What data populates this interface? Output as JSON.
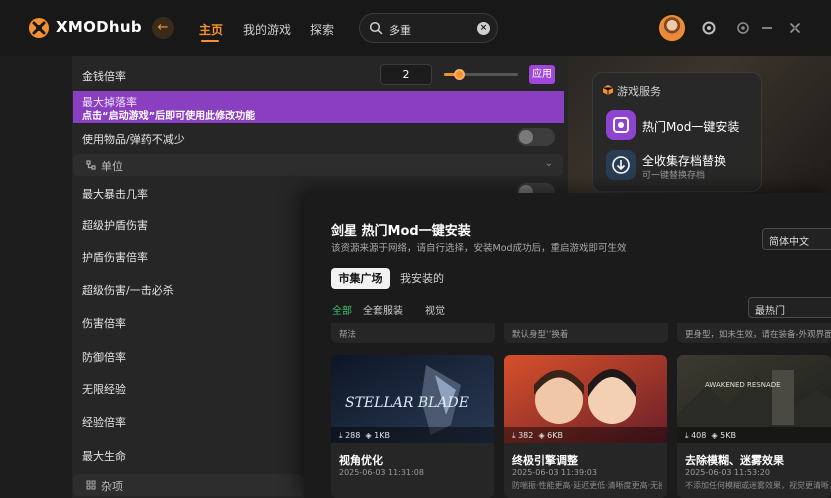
{
  "app": {
    "name": "XMODhub"
  },
  "colors": {
    "accent": "#f5922f",
    "purple": "#a046d8",
    "highlight_row": "#8a3fc0",
    "green": "#3cc36c"
  },
  "nav": {
    "items": [
      "主页",
      "我的游戏",
      "探索"
    ],
    "active": "主页"
  },
  "search": {
    "value": "多重"
  },
  "settings": {
    "money_rate": {
      "label": "金钱倍率",
      "value": "2",
      "slider_fraction": 0.2,
      "apply": "应用"
    },
    "drop_rate": {
      "label": "最大掉落率",
      "hint": "点击“启动游戏”后即可使用此修改功能"
    },
    "no_consume": {
      "label": "使用物品/弹药不减少"
    },
    "unit_section": "单位",
    "unit_items": [
      "最大暴击几率",
      "超级护盾伤害",
      "护盾伤害倍率",
      "超级伤害/一击必杀",
      "伤害倍率",
      "防御倍率",
      "无限经验",
      "经验倍率",
      "最大生命"
    ],
    "misc_section": "杂项"
  },
  "services": {
    "title": "游戏服务",
    "items": [
      {
        "label": "热门Mod一键安装",
        "sub": ""
      },
      {
        "label": "全收集存档替换",
        "sub": "可一键替换存档"
      }
    ]
  },
  "modal": {
    "title": "剑星 热门Mod一键安装",
    "desc": "该资源来源于网络，请自行选择，安装Mod成功后，重启游戏即可生效",
    "language": "简体中文",
    "tabs": [
      "市集广场",
      "我安装的"
    ],
    "filters": [
      "全部",
      "全套服装",
      "视觉"
    ],
    "sort": "最热门",
    "peek": [
      "帮法",
      "默认身型‘’换着",
      "更身型，如未生效，请在装备-外观界面切换服"
    ],
    "mods": [
      {
        "name": "视角优化",
        "downloads": "288",
        "size": "1KB",
        "date": "2025-06-03 11:31:08",
        "desc": "",
        "thumb_text": "STELLAR BLADE"
      },
      {
        "name": "终极引擎调整",
        "downloads": "382",
        "size": "6KB",
        "date": "2025-06-03 11:39:03",
        "desc": "防喘振·性能更高·延迟更低·清晰度更高·无损",
        "thumb_text": ""
      },
      {
        "name": "去除模糊、迷雾效果",
        "downloads": "408",
        "size": "5KB",
        "date": "2025-06-03 11:53:20",
        "desc": "不添加任何模糊或迷雾效果，视觉更清晰，性能更好",
        "thumb_text": "AWAKENED RESNADE"
      }
    ]
  }
}
